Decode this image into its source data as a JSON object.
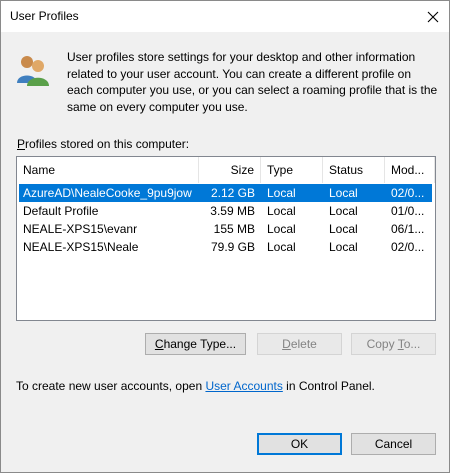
{
  "window": {
    "title": "User Profiles"
  },
  "intro": {
    "icon": "users-icon",
    "text": "User profiles store settings for your desktop and other information related to your user account. You can create a different profile on each computer you use, or you can select a roaming profile that is the same on every computer you use."
  },
  "profiles_label": {
    "first_letter": "P",
    "rest": "rofiles stored on this computer:"
  },
  "table": {
    "columns": [
      "Name",
      "Size",
      "Type",
      "Status",
      "Mod..."
    ],
    "rows": [
      {
        "name": "AzureAD\\NealeCooke_9pu9jow",
        "size": "2.12 GB",
        "type": "Local",
        "status": "Local",
        "modified": "02/0...",
        "selected": true
      },
      {
        "name": "Default Profile",
        "size": "3.59 MB",
        "type": "Local",
        "status": "Local",
        "modified": "01/0...",
        "selected": false
      },
      {
        "name": "NEALE-XPS15\\evanr",
        "size": "155 MB",
        "type": "Local",
        "status": "Local",
        "modified": "06/1...",
        "selected": false
      },
      {
        "name": "NEALE-XPS15\\Neale",
        "size": "79.9 GB",
        "type": "Local",
        "status": "Local",
        "modified": "02/0...",
        "selected": false
      }
    ]
  },
  "buttons": {
    "change_type": {
      "first": "C",
      "rest": "hange Type..."
    },
    "delete": {
      "first": "D",
      "rest": "elete"
    },
    "copy_to": {
      "pre": "Copy ",
      "ul": "T",
      "post": "o..."
    }
  },
  "footer": {
    "text_before": "To create new user accounts, open ",
    "link": "User Accounts",
    "text_after": " in Control Panel."
  },
  "dialog": {
    "ok": "OK",
    "cancel": "Cancel"
  }
}
